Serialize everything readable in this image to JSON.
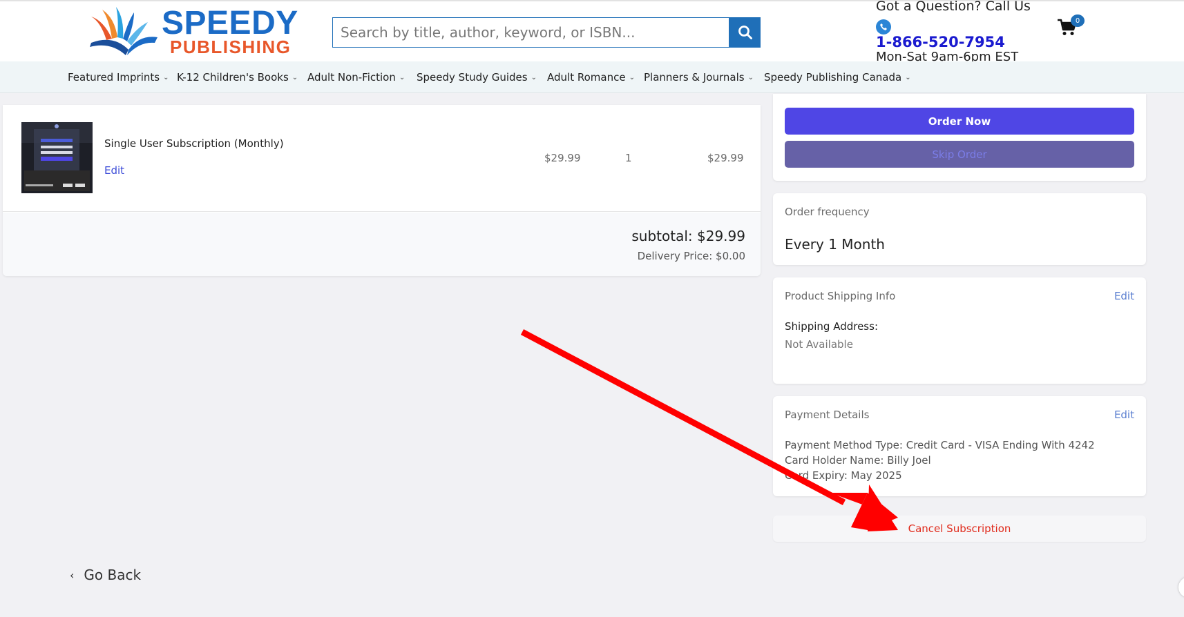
{
  "header": {
    "logo_line1": "SPEEDY",
    "logo_line2": "PUBLISHING",
    "search_placeholder": "Search by title, author, keyword, or ISBN...",
    "contact_question": "Got a Question? Call Us",
    "phone": "1-866-520-7954",
    "hours": "Mon-Sat 9am-6pm EST",
    "cart_count": "0"
  },
  "nav": {
    "items": [
      {
        "label": "Featured Imprints"
      },
      {
        "label": "K-12 Children's Books"
      },
      {
        "label": "Adult Non-Fiction"
      },
      {
        "label": "Speedy Study Guides"
      },
      {
        "label": "Adult Romance"
      },
      {
        "label": "Planners & Journals"
      },
      {
        "label": "Speedy Publishing Canada"
      }
    ]
  },
  "order_item": {
    "name": "Single User Subscription (Monthly)",
    "edit_label": "Edit",
    "price": "$29.99",
    "quantity": "1",
    "total": "$29.99"
  },
  "summary": {
    "subtotal": "subtotal: $29.99",
    "delivery": "Delivery Price: $0.00"
  },
  "actions": {
    "order_now": "Order Now",
    "skip_order": "Skip Order"
  },
  "frequency": {
    "label": "Order frequency",
    "value": "Every 1 Month"
  },
  "shipping": {
    "label": "Product Shipping Info",
    "edit_label": "Edit",
    "address_label": "Shipping Address:",
    "address_value": "Not Available"
  },
  "payment": {
    "label": "Payment Details",
    "edit_label": "Edit",
    "method": "Payment Method Type: Credit Card - VISA Ending With 4242",
    "holder": "Card Holder Name: Billy Joel",
    "expiry": "Card Expiry: May 2025"
  },
  "cancel": {
    "label": "Cancel Subscription"
  },
  "footer": {
    "go_back": "Go Back"
  },
  "colors": {
    "brand_blue": "#1b6bc6",
    "brand_orange": "#e8572a",
    "order_button": "#4f46e5",
    "cancel_red": "#e02a1b",
    "annotation_arrow": "#ff0000"
  }
}
